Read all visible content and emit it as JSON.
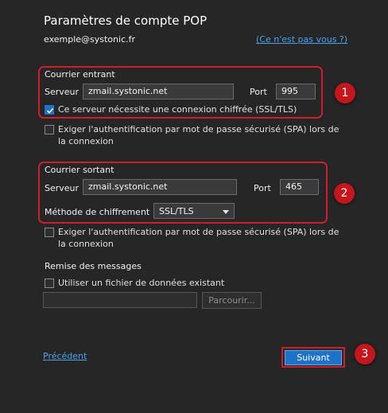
{
  "header": {
    "title": "Paramètres de compte POP",
    "email": "exemple@systonic.fr",
    "not_you_link": "(Ce n'est pas vous ?)"
  },
  "incoming": {
    "section_label": "Courrier entrant",
    "server_label": "Serveur",
    "server_value": "zmail.systonic.net",
    "port_label": "Port",
    "port_value": "995",
    "ssl_checkbox_label": "Ce serveur nécessite une connexion chiffrée (SSL/TLS)",
    "ssl_checked": true,
    "spa_checkbox_label": "Exiger l'authentification par mot de passe sécurisé (SPA) lors de la connexion",
    "spa_checked": false
  },
  "outgoing": {
    "section_label": "Courrier sortant",
    "server_label": "Serveur",
    "server_value": "zmail.systonic.net",
    "port_label": "Port",
    "port_value": "465",
    "encryption_label": "Méthode de chiffrement",
    "encryption_value": "SSL/TLS",
    "spa_checkbox_label": "Exiger l'authentification par mot de passe sécurisé (SPA) lors de la connexion",
    "spa_checked": false
  },
  "delivery": {
    "section_label": "Remise des messages",
    "existing_file_label": "Utiliser un fichier de données existant",
    "existing_file_checked": false,
    "file_path_value": "",
    "browse_button": "Parcourir..."
  },
  "footer": {
    "previous_link": "Précédent",
    "next_button": "Suivant"
  },
  "annotations": {
    "badge_1": "1",
    "badge_2": "2",
    "badge_3": "3",
    "highlight_color": "#cc1f2a",
    "badge_color": "#c4161c",
    "accent_color": "#1e73c8"
  }
}
